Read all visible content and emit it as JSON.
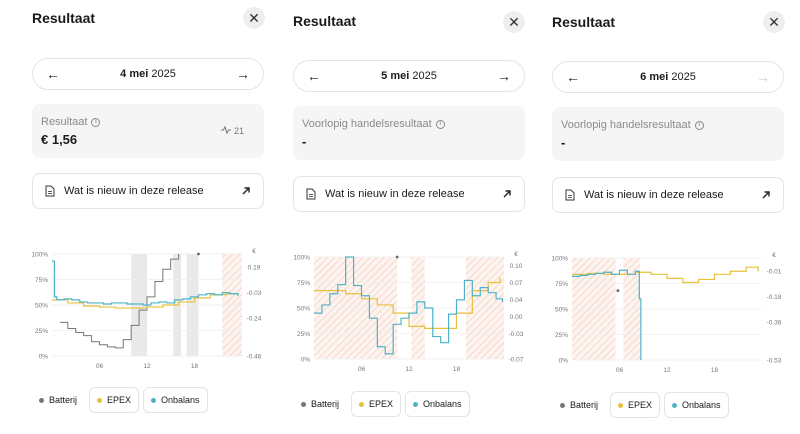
{
  "panels": [
    {
      "title": "Resultaat",
      "date_day": "4 mei",
      "date_year": "2025",
      "next_enabled": true,
      "result_label": "Resultaat",
      "result_value": "€ 1,56",
      "trade_count": "21",
      "release_label": "Wat is nieuw in deze release",
      "chart_data": {
        "type": "line",
        "left_axis_label": "%",
        "left_ticks": [
          "100%",
          "75%",
          "50%",
          "25%",
          "0%"
        ],
        "right_axis_label": "€",
        "right_ticks": [
          "0.19",
          "-0.03",
          "-0.24",
          "-0.46"
        ],
        "x_ticks": [
          "06",
          "12",
          "18"
        ],
        "xlim": [
          0,
          24
        ],
        "ylim_left": [
          0,
          100
        ],
        "series": [
          {
            "name": "Batterij",
            "color": "#777777",
            "x": [
              1,
              2,
              3,
              4,
              5,
              6,
              7,
              8,
              9,
              10,
              11,
              12,
              13,
              14,
              15,
              16
            ],
            "y": [
              33,
              27,
              23,
              20,
              14,
              11,
              9,
              8,
              16,
              30,
              45,
              58,
              73,
              85,
              95,
              100
            ]
          },
          {
            "name": "EPEX",
            "color": "#e8c13a",
            "x": [
              0,
              2,
              4,
              6,
              8,
              10,
              12,
              14,
              16,
              18,
              20,
              22,
              23.5
            ],
            "y": [
              55,
              52,
              49,
              48,
              47,
              47,
              48,
              50,
              53,
              57,
              60,
              61,
              59
            ]
          },
          {
            "name": "Onbalans",
            "color": "#4eb3c8",
            "x": [
              0,
              0.3,
              0.6,
              1.5,
              2.5,
              3.5,
              4.5,
              5.5,
              6.5,
              7.5,
              8.5,
              9.5,
              10.5,
              11.5,
              12.5,
              13.5,
              14.5,
              15.5,
              16.5,
              17.5,
              18.5,
              19.5,
              20.5,
              21.5,
              22.5,
              23.5
            ],
            "y": [
              93,
              58,
              55,
              56,
              55,
              53,
              52,
              52,
              51,
              52,
              52,
              51,
              51,
              50,
              52,
              53,
              52,
              55,
              56,
              58,
              60,
              61,
              60,
              62,
              61,
              59
            ]
          }
        ]
      }
    },
    {
      "title": "Resultaat",
      "date_day": "5 mei",
      "date_year": "2025",
      "next_enabled": true,
      "result_label": "Voorlopig handelsresultaat",
      "result_value": "-",
      "trade_count": "",
      "release_label": "Wat is nieuw in deze release",
      "chart_data": {
        "type": "line",
        "left_axis_label": "%",
        "left_ticks": [
          "100%",
          "75%",
          "50%",
          "25%",
          "0%"
        ],
        "right_axis_label": "€",
        "right_ticks": [
          "0.10",
          "0.07",
          "0.04",
          "0.00",
          "-0.03",
          "-0.07"
        ],
        "x_ticks": [
          "06",
          "12",
          "18"
        ],
        "xlim": [
          0,
          24
        ],
        "ylim_left": [
          0,
          100
        ],
        "series": [
          {
            "name": "EPEX",
            "color": "#e8c13a",
            "x": [
              0,
              2,
              4,
              6,
              8,
              10,
              12,
              14,
              16,
              18,
              20,
              22,
              23.5
            ],
            "y": [
              67,
              67,
              64,
              59,
              53,
              45,
              32,
              30,
              30,
              45,
              67,
              75,
              80
            ]
          },
          {
            "name": "Onbalans",
            "color": "#4eb3c8",
            "x": [
              0,
              1,
              2,
              3,
              4,
              5,
              6,
              7,
              8,
              9,
              10,
              11,
              12,
              13,
              14,
              15,
              16,
              17,
              18,
              19,
              20,
              21,
              22,
              23,
              23.8
            ],
            "y": [
              45,
              53,
              64,
              73,
              100,
              72,
              62,
              40,
              12,
              5,
              34,
              40,
              45,
              56,
              50,
              22,
              16,
              44,
              58,
              77,
              62,
              70,
              65,
              59,
              56
            ]
          }
        ]
      }
    },
    {
      "title": "Resultaat",
      "date_day": "6 mei",
      "date_year": "2025",
      "next_enabled": false,
      "result_label": "Voorlopig handelsresultaat",
      "result_value": "-",
      "trade_count": "",
      "release_label": "Wat is nieuw in deze release",
      "chart_data": {
        "type": "line",
        "left_axis_label": "%",
        "left_ticks": [
          "100%",
          "75%",
          "50%",
          "25%",
          "0%"
        ],
        "right_axis_label": "€",
        "right_ticks": [
          "-0.01",
          "-0.18",
          "-0.36",
          "-0.53"
        ],
        "x_ticks": [
          "06",
          "12",
          "18"
        ],
        "xlim": [
          0,
          24
        ],
        "ylim_left": [
          0,
          100
        ],
        "series": [
          {
            "name": "EPEX",
            "color": "#e8c13a",
            "x": [
              0,
              2,
              4,
              6,
              8,
              10,
              12,
              14,
              16,
              18,
              20,
              22,
              23.5
            ],
            "y": [
              84,
              85,
              84,
              84,
              86,
              84,
              80,
              76,
              79,
              84,
              87,
              91,
              87
            ]
          },
          {
            "name": "Onbalans",
            "color": "#4eb3c8",
            "x": [
              0,
              1,
              2,
              3,
              4,
              5,
              6,
              7,
              8,
              8.5,
              8.7
            ],
            "y": [
              82,
              83,
              84,
              85,
              86,
              84,
              88,
              84,
              87,
              60,
              0
            ]
          }
        ]
      }
    }
  ],
  "legend": {
    "batterij": "Batterij",
    "epex": "EPEX",
    "onbalans": "Onbalans"
  },
  "colors": {
    "batterij": "#777777",
    "epex": "#e8c13a",
    "onbalans": "#4eb3c8",
    "hatch": "#f3d2c6",
    "grey_band": "#e9e9e9"
  }
}
